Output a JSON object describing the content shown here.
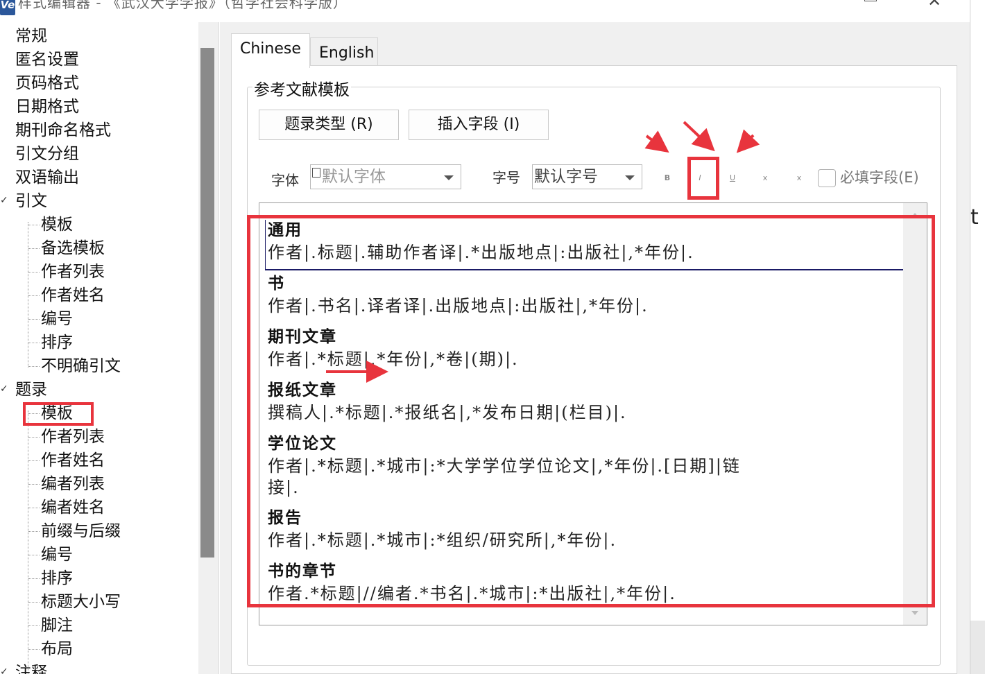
{
  "window": {
    "title": "样式编辑器 - 《武汉大学学报》（哲学社会科学版）",
    "app_icon_text": "Ve",
    "minimize": "",
    "maximize": "",
    "close": "✕"
  },
  "tree": {
    "items": [
      {
        "label": "常规",
        "level": 1
      },
      {
        "label": "匿名设置",
        "level": 1
      },
      {
        "label": "页码格式",
        "level": 1
      },
      {
        "label": "日期格式",
        "level": 1
      },
      {
        "label": "期刊命名格式",
        "level": 1
      },
      {
        "label": "引文分组",
        "level": 1
      },
      {
        "label": "双语输出",
        "level": 1
      },
      {
        "label": "引文",
        "level": 1,
        "expanded": true
      },
      {
        "label": "模板",
        "level": 2
      },
      {
        "label": "备选模板",
        "level": 2
      },
      {
        "label": "作者列表",
        "level": 2
      },
      {
        "label": "作者姓名",
        "level": 2
      },
      {
        "label": "编号",
        "level": 2
      },
      {
        "label": "排序",
        "level": 2
      },
      {
        "label": "不明确引文",
        "level": 2
      },
      {
        "label": "题录",
        "level": 1,
        "expanded": true
      },
      {
        "label": "模板",
        "level": 2,
        "selected": true
      },
      {
        "label": "作者列表",
        "level": 2
      },
      {
        "label": "作者姓名",
        "level": 2
      },
      {
        "label": "编者列表",
        "level": 2
      },
      {
        "label": "编者姓名",
        "level": 2
      },
      {
        "label": "前缀与后缀",
        "level": 2
      },
      {
        "label": "编号",
        "level": 2
      },
      {
        "label": "排序",
        "level": 2
      },
      {
        "label": "标题大小写",
        "level": 2
      },
      {
        "label": "脚注",
        "level": 2
      },
      {
        "label": "布局",
        "level": 2
      },
      {
        "label": "注释",
        "level": 1,
        "expanded": true
      }
    ]
  },
  "tabs": [
    {
      "label": "Chinese",
      "active": true
    },
    {
      "label": "English",
      "active": false
    }
  ],
  "group": {
    "label": "参考文献模板",
    "btn_type": "题录类型 (R)",
    "btn_insert": "插入字段 (I)",
    "font_label": "字体",
    "font_value": "默认字体",
    "size_label": "字号",
    "size_value": "默认字号",
    "bold": "B",
    "italic": "I",
    "underline": "U",
    "superscript": "x",
    "subscript": "x",
    "required_label": "必填字段(E)",
    "required_checked": false
  },
  "templates": [
    {
      "type": "通用",
      "template": "作者|.标题|.辅助作者译|.*出版地点|:出版社|,*年份|."
    },
    {
      "type": "书",
      "template": "作者|.书名|.译者译|.出版地点|:出版社|,*年份|."
    },
    {
      "type": "期刊文章",
      "template": "作者|.*标题|,*年份|,*卷|(期)|."
    },
    {
      "type": "报纸文章",
      "template": "撰稿人|.*标题|.*报纸名|,*发布日期|(栏目)|."
    },
    {
      "type": "学位论文",
      "template_line1": "作者|.*标题|.*城市|:*大学学位学位论文|,*年份|.[日期]|链",
      "template_line2": "接|."
    },
    {
      "type": "报告",
      "template": "作者|.*标题|.*城市|:*组织/研究所|,*年份|."
    },
    {
      "type": "书的章节",
      "template": "作者.*标题|//编者.*书名|.*城市|:*出版社|,*年份|."
    }
  ],
  "right_strip_text": "t a",
  "colors": {
    "annotation_red": "#e8343d",
    "tree_scroll_thumb": "#8a8a8a",
    "panel_bg": "#f0f0f0"
  }
}
